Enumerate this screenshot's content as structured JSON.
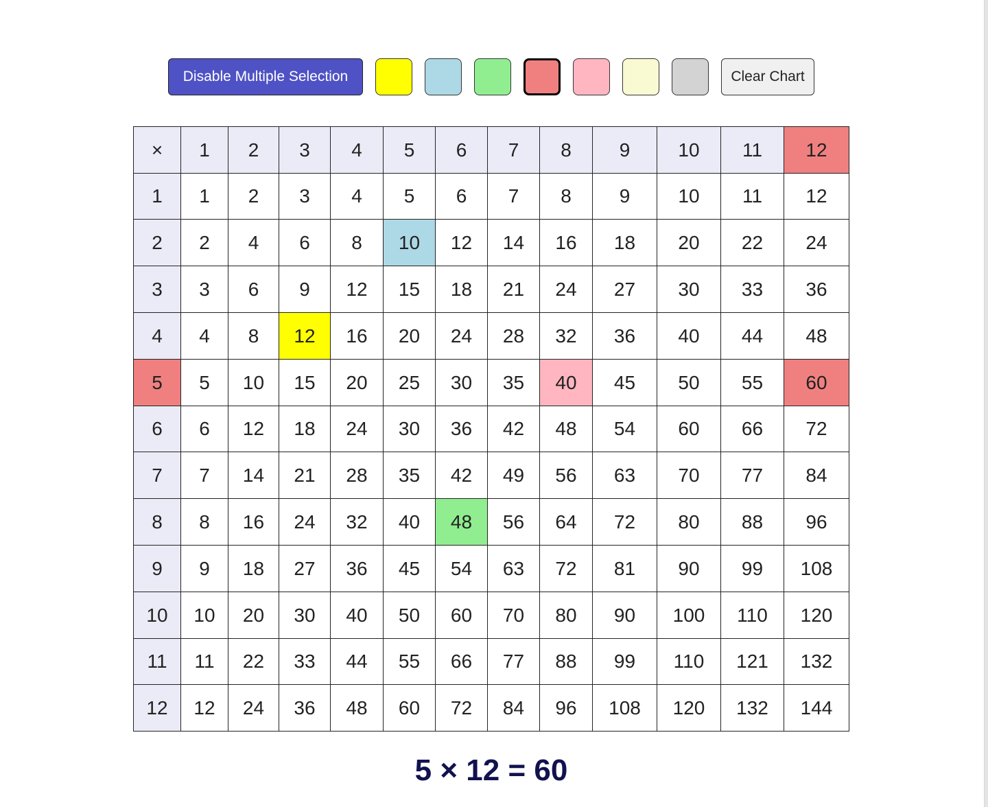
{
  "toolbar": {
    "toggle_label": "Disable Multiple Selection",
    "swatches": [
      {
        "name": "yellow",
        "color": "#ffff00"
      },
      {
        "name": "lightblue",
        "color": "#add8e6"
      },
      {
        "name": "lightgreen",
        "color": "#90ee90"
      },
      {
        "name": "lightcoral",
        "color": "#f08080",
        "selected": true
      },
      {
        "name": "pink",
        "color": "#ffb6c1"
      },
      {
        "name": "lightgoldenrod",
        "color": "#fafad2"
      },
      {
        "name": "lightgray",
        "color": "#d3d3d3"
      }
    ],
    "clear_label": "Clear Chart"
  },
  "table": {
    "corner": "×",
    "header_bg": "#ebebf7",
    "columns": [
      "1",
      "2",
      "3",
      "4",
      "5",
      "6",
      "7",
      "8",
      "9",
      "10",
      "11",
      "12"
    ],
    "rows": [
      {
        "label": "1",
        "cells": [
          "1",
          "2",
          "3",
          "4",
          "5",
          "6",
          "7",
          "8",
          "9",
          "10",
          "11",
          "12"
        ]
      },
      {
        "label": "2",
        "cells": [
          "2",
          "4",
          "6",
          "8",
          "10",
          "12",
          "14",
          "16",
          "18",
          "20",
          "22",
          "24"
        ]
      },
      {
        "label": "3",
        "cells": [
          "3",
          "6",
          "9",
          "12",
          "15",
          "18",
          "21",
          "24",
          "27",
          "30",
          "33",
          "36"
        ]
      },
      {
        "label": "4",
        "cells": [
          "4",
          "8",
          "12",
          "16",
          "20",
          "24",
          "28",
          "32",
          "36",
          "40",
          "44",
          "48"
        ]
      },
      {
        "label": "5",
        "cells": [
          "5",
          "10",
          "15",
          "20",
          "25",
          "30",
          "35",
          "40",
          "45",
          "50",
          "55",
          "60"
        ]
      },
      {
        "label": "6",
        "cells": [
          "6",
          "12",
          "18",
          "24",
          "30",
          "36",
          "42",
          "48",
          "54",
          "60",
          "66",
          "72"
        ]
      },
      {
        "label": "7",
        "cells": [
          "7",
          "14",
          "21",
          "28",
          "35",
          "42",
          "49",
          "56",
          "63",
          "70",
          "77",
          "84"
        ]
      },
      {
        "label": "8",
        "cells": [
          "8",
          "16",
          "24",
          "32",
          "40",
          "48",
          "56",
          "64",
          "72",
          "80",
          "88",
          "96"
        ]
      },
      {
        "label": "9",
        "cells": [
          "9",
          "18",
          "27",
          "36",
          "45",
          "54",
          "63",
          "72",
          "81",
          "90",
          "99",
          "108"
        ]
      },
      {
        "label": "10",
        "cells": [
          "10",
          "20",
          "30",
          "40",
          "50",
          "60",
          "70",
          "80",
          "90",
          "100",
          "110",
          "120"
        ]
      },
      {
        "label": "11",
        "cells": [
          "11",
          "22",
          "33",
          "44",
          "55",
          "66",
          "77",
          "88",
          "99",
          "110",
          "121",
          "132"
        ]
      },
      {
        "label": "12",
        "cells": [
          "12",
          "24",
          "36",
          "48",
          "60",
          "72",
          "84",
          "96",
          "108",
          "120",
          "132",
          "144"
        ]
      }
    ],
    "highlights": [
      {
        "row": 0,
        "col": 12,
        "color": "#f08080"
      },
      {
        "row": 5,
        "col": 0,
        "color": "#f08080"
      },
      {
        "row": 5,
        "col": 12,
        "color": "#f08080"
      },
      {
        "row": 2,
        "col": 5,
        "color": "#add8e6"
      },
      {
        "row": 4,
        "col": 3,
        "color": "#ffff00"
      },
      {
        "row": 5,
        "col": 8,
        "color": "#ffb6c1"
      },
      {
        "row": 8,
        "col": 6,
        "color": "#90ee90"
      }
    ]
  },
  "result": "5 × 12 = 60"
}
